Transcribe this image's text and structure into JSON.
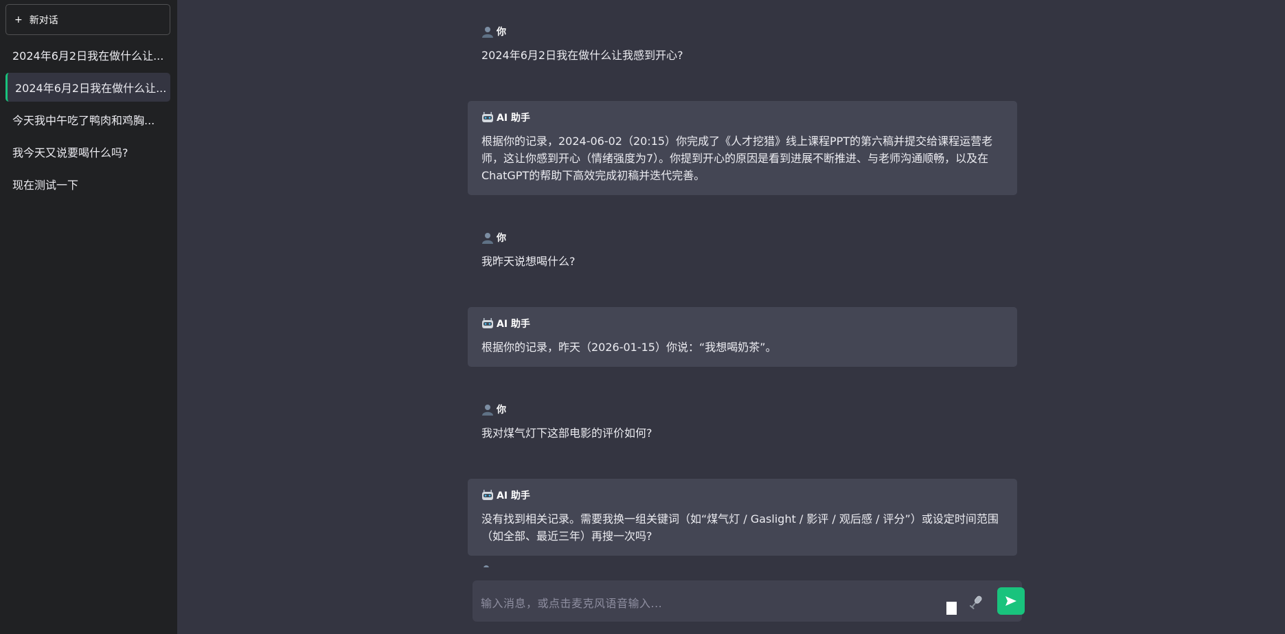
{
  "sidebar": {
    "new_chat_label": "新对话",
    "new_chat_icon": "+",
    "history": [
      {
        "label": "2024年6月2日我在做什么让..."
      },
      {
        "label": "2024年6月2日我在做什么让..."
      },
      {
        "label": "今天我中午吃了鸭肉和鸡胸..."
      },
      {
        "label": "我今天又说要喝什么吗?"
      },
      {
        "label": "现在测试一下"
      }
    ]
  },
  "messages": [
    {
      "role": "user",
      "sender": "你",
      "text": "2024年6月2日我在做什么让我感到开心?"
    },
    {
      "role": "ai",
      "sender": "AI 助手",
      "text": "根据你的记录，2024-06-02（20:15）你完成了《人才挖猎》线上课程PPT的第六稿并提交给课程运营老师，这让你感到开心（情绪强度为7）。你提到开心的原因是看到进展不断推进、与老师沟通顺畅，以及在ChatGPT的帮助下高效完成初稿并迭代完善。"
    },
    {
      "role": "user",
      "sender": "你",
      "text": "我昨天说想喝什么?"
    },
    {
      "role": "ai",
      "sender": "AI 助手",
      "text": "根据你的记录，昨天（2026-01-15）你说：“我想喝奶茶”。"
    },
    {
      "role": "user",
      "sender": "你",
      "text": "我对煤气灯下这部电影的评价如何?"
    },
    {
      "role": "ai",
      "sender": "AI 助手",
      "text": "没有找到相关记录。需要我换一组关键词（如“煤气灯 / Gaslight / 影评 / 观后感 / 评分”）或设定时间范围（如全部、最近三年）再搜一次吗?"
    }
  ],
  "input": {
    "placeholder": "输入消息，或点击麦克风语音输入...",
    "value": ""
  },
  "icons": {
    "user_avatar": "user-avatar-icon",
    "ai_avatar": "robot-icon",
    "mic": "microphone-icon",
    "send": "send-icon"
  },
  "colors": {
    "accent": "#19c37d",
    "sidebar_bg": "#202123",
    "chat_bg": "#343541",
    "ai_bubble_bg": "#444654",
    "input_bg": "#40414f"
  }
}
